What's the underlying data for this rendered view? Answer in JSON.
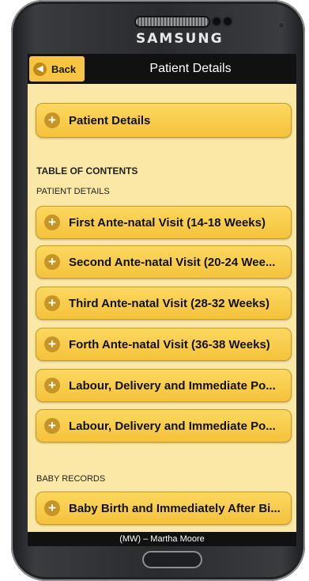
{
  "device": {
    "brand": "SAMSUNG"
  },
  "header": {
    "back_label": "Back",
    "title": "Patient Details"
  },
  "main": {
    "patient_button": "Patient Details",
    "toc_heading": "TABLE OF CONTENTS",
    "patient_section": "PATIENT DETAILS",
    "visits": [
      "First Ante-natal Visit (14-18 Weeks)",
      "Second Ante-natal Visit (20-24 Wee...",
      "Third Ante-natal Visit (28-32 Weeks)",
      "Forth Ante-natal Visit (36-38 Weeks)",
      "Labour, Delivery and Immediate Po...",
      "Labour, Delivery and Immediate Po..."
    ],
    "baby_section": "BABY RECORDS",
    "baby_items": [
      "Baby Birth and Immediately After Bi..."
    ]
  },
  "footer": {
    "user": "(MW) – Martha Moore"
  },
  "icons": {
    "back": "arrow-left-icon",
    "expand": "plus-icon"
  },
  "colors": {
    "background": "#fce8a6",
    "button": "#f8cd4e",
    "bar": "#111111"
  }
}
